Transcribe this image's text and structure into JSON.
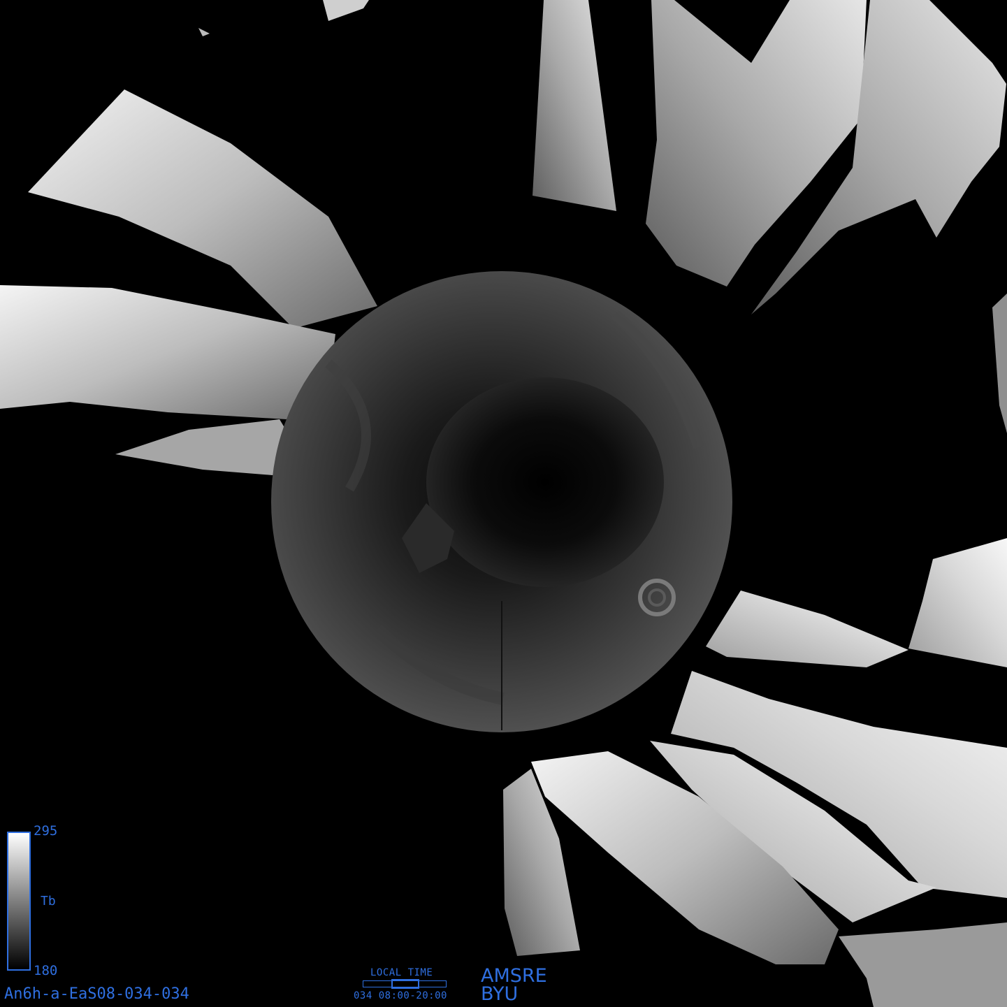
{
  "image_id": "An6h-a-EaS08-034-034",
  "legend": {
    "max_value": "295",
    "min_value": "180",
    "variable_label": "Tb",
    "gradient_top_color": "#ffffff",
    "gradient_bottom_color": "#000000"
  },
  "local_time": {
    "title": "LOCAL TIME",
    "range_text": "034 08:00-20:00"
  },
  "credits": {
    "instrument": "AMSRE",
    "organization": "BYU"
  },
  "colors": {
    "annotation": "#2f6fe0",
    "background": "#000000"
  }
}
